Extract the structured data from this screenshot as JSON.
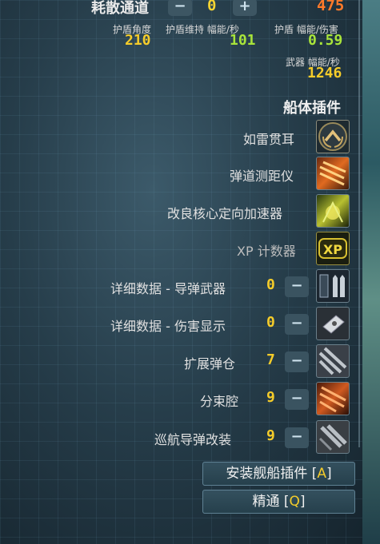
{
  "header": {
    "dissipation_label": "耗散通道",
    "dissipation_minus": "−",
    "dissipation_value": "0",
    "dissipation_plus": "+",
    "orange_value": "475"
  },
  "stats": {
    "shield_arc_label": "护盾角度",
    "shield_arc_value": "210",
    "shield_upkeep_label": "护盾维持 幅能/秒",
    "shield_upkeep_value": "101",
    "shield_eff_label": "护盾 幅能/伤害",
    "shield_eff_value": "0.59",
    "weapon_flux_label": "武器 幅能/秒",
    "weapon_flux_value": "1246"
  },
  "section_title": "船体插件",
  "hullmods": [
    {
      "label": "如雷贯耳",
      "icon": "chevron-laurel-icon"
    },
    {
      "label": "弹道测距仪",
      "icon": "ballistic-rangefinder-icon"
    },
    {
      "label": "改良核心定向加速器",
      "icon": "core-accelerator-icon"
    },
    {
      "label": "XP 计数器",
      "icon": "xp-counter-icon"
    }
  ],
  "adjustable_mods": [
    {
      "label": "详细数据 - 导弹武器",
      "count": "0",
      "minus": "−",
      "icon": "missile-data-icon"
    },
    {
      "label": "详细数据 - 伤害显示",
      "count": "0",
      "minus": "−",
      "icon": "damage-display-icon"
    },
    {
      "label": "扩展弹仓",
      "count": "7",
      "minus": "−",
      "icon": "expanded-magazine-icon"
    },
    {
      "label": "分束腔",
      "count": "9",
      "minus": "−",
      "icon": "beam-splitter-icon"
    },
    {
      "label": "巡航导弹改装",
      "count": "9",
      "minus": "−",
      "icon": "cruise-missile-icon"
    }
  ],
  "buttons": {
    "install_label": "安装舰船插件 [",
    "install_key": "A",
    "install_close": "]",
    "master_label": "精通 [",
    "master_key": "Q",
    "master_close": "]"
  }
}
